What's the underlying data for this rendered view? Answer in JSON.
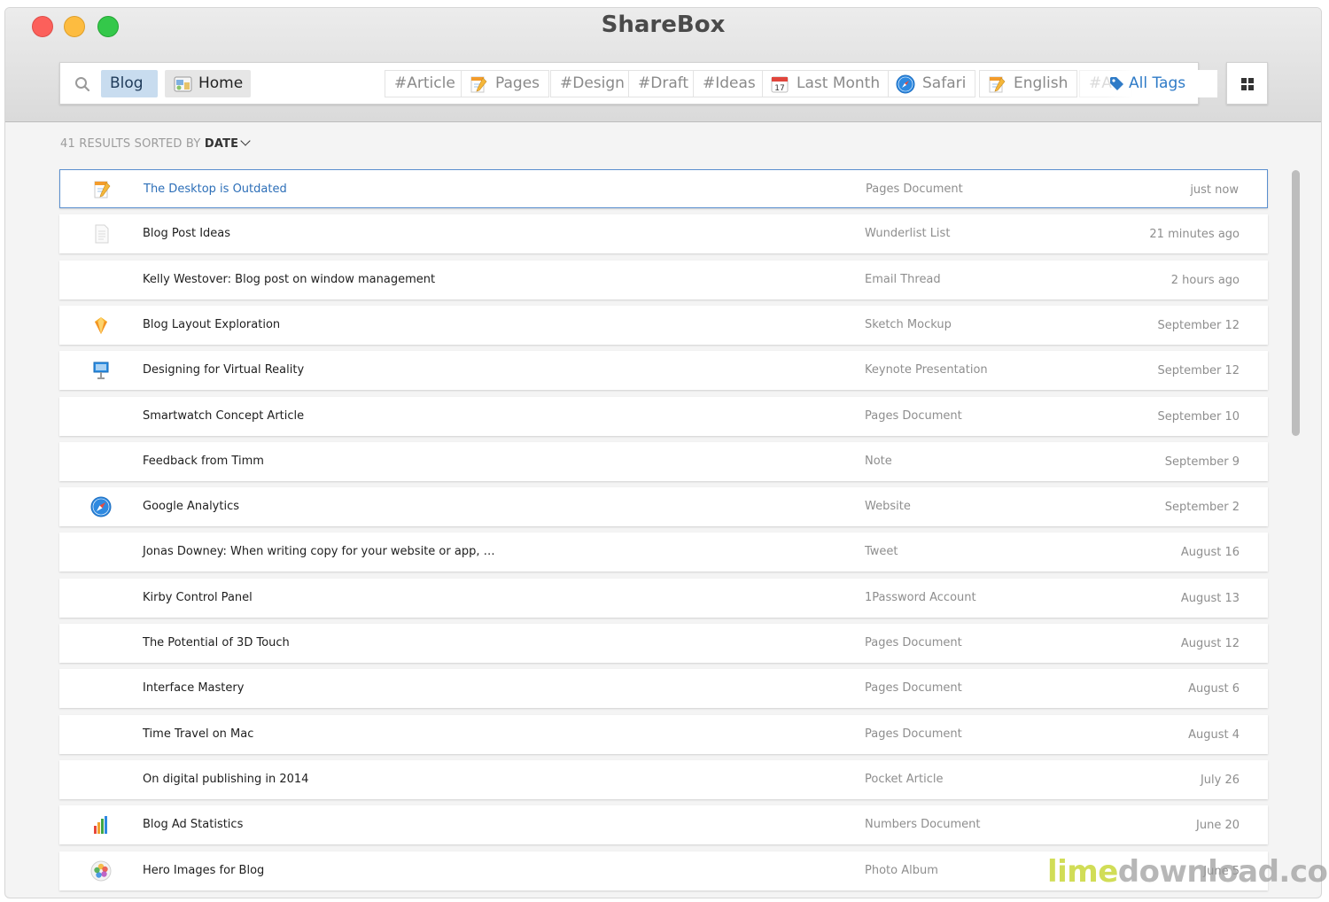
{
  "window": {
    "title": "ShareBox"
  },
  "search": {
    "tokens": [
      {
        "label": "Blog"
      },
      {
        "label": "Home"
      }
    ]
  },
  "tags": [
    {
      "label": "#Article",
      "icon": ""
    },
    {
      "label": "Pages",
      "icon": "pages-icon"
    },
    {
      "label": "#Design",
      "icon": ""
    },
    {
      "label": "#Draft",
      "icon": ""
    },
    {
      "label": "#Ideas",
      "icon": ""
    },
    {
      "label": "Last Month",
      "icon": "calendar-icon"
    },
    {
      "label": "Safari",
      "icon": "safari-icon"
    },
    {
      "label": "English",
      "icon": "pages-icon"
    },
    {
      "label": "#A",
      "icon": ""
    }
  ],
  "all_tags_label": "All Tags",
  "results": {
    "count_text": "41 RESULTS SORTED BY",
    "sort_field": "DATE"
  },
  "rows": [
    {
      "title": "The Desktop is Outdated",
      "kind": "Pages Document",
      "date": "just now",
      "icon": "pages-icon"
    },
    {
      "title": "Blog Post Ideas",
      "kind": "Wunderlist List",
      "date": "21 minutes ago",
      "icon": "document-icon"
    },
    {
      "title": "Kelly Westover: Blog post on window management",
      "kind": "Email Thread",
      "date": "2 hours ago",
      "icon": ""
    },
    {
      "title": "Blog Layout Exploration",
      "kind": "Sketch Mockup",
      "date": "September 12",
      "icon": "sketch-icon"
    },
    {
      "title": "Designing for Virtual Reality",
      "kind": "Keynote Presentation",
      "date": "September 12",
      "icon": "keynote-icon"
    },
    {
      "title": "Smartwatch Concept Article",
      "kind": "Pages Document",
      "date": "September 10",
      "icon": ""
    },
    {
      "title": "Feedback from Timm",
      "kind": "Note",
      "date": "September 9",
      "icon": ""
    },
    {
      "title": "Google Analytics",
      "kind": "Website",
      "date": "September 2",
      "icon": "safari-icon"
    },
    {
      "title": "Jonas Downey: When writing copy for your website or app, …",
      "kind": "Tweet",
      "date": "August 16",
      "icon": ""
    },
    {
      "title": "Kirby Control Panel",
      "kind": "1Password Account",
      "date": "August 13",
      "icon": ""
    },
    {
      "title": "The Potential of 3D Touch",
      "kind": "Pages Document",
      "date": "August 12",
      "icon": ""
    },
    {
      "title": "Interface Mastery",
      "kind": "Pages Document",
      "date": "August 6",
      "icon": ""
    },
    {
      "title": "Time Travel on Mac",
      "kind": "Pages Document",
      "date": "August 4",
      "icon": ""
    },
    {
      "title": "On digital publishing in 2014",
      "kind": "Pocket Article",
      "date": "July 26",
      "icon": ""
    },
    {
      "title": "Blog Ad Statistics",
      "kind": "Numbers Document",
      "date": "June 20",
      "icon": "numbers-icon"
    },
    {
      "title": "Hero Images for Blog",
      "kind": "Photo Album",
      "date": "June 5",
      "icon": "photos-icon"
    }
  ],
  "watermark": {
    "part1": "lime",
    "part2": "download.com"
  }
}
